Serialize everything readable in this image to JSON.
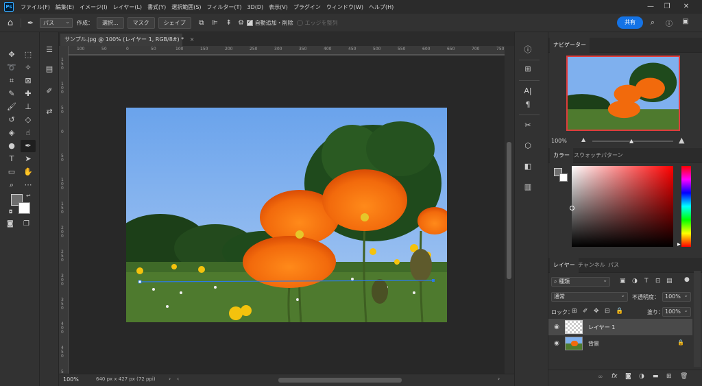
{
  "app": {
    "logo": "Ps"
  },
  "menu": [
    "ファイル(F)",
    "編集(E)",
    "イメージ(I)",
    "レイヤー(L)",
    "書式(Y)",
    "選択範囲(S)",
    "フィルター(T)",
    "3D(D)",
    "表示(V)",
    "プラグイン",
    "ウィンドウ(W)",
    "ヘルプ(H)"
  ],
  "window_controls": {
    "minimize": "—",
    "restore": "❐",
    "close": "✕"
  },
  "options": {
    "mode_select": "パス",
    "make_label": "作成：",
    "selection_btn": "選択...",
    "mask_btn": "マスク",
    "shape_btn": "シェイプ",
    "auto_add_delete": "自動追加・削除",
    "align_edges": "エッジを整列",
    "share": "共有"
  },
  "document": {
    "tab_title": "サンプル.jpg @ 100% (レイヤー 1, RGB/8#) *",
    "zoom": "100%",
    "status_info": "640 px x 427 px (72 ppi)"
  },
  "ruler": {
    "top": [
      "100",
      "50",
      "0",
      "50",
      "100",
      "150",
      "200",
      "250",
      "300",
      "350",
      "400",
      "450",
      "500",
      "550",
      "600",
      "650",
      "700",
      "750"
    ],
    "left": [
      "1 5 0",
      "1 0 0",
      "5 0",
      "0",
      "5 0",
      "1 0 0",
      "1 5 0",
      "2 0 0",
      "2 5 0",
      "3 0 0",
      "3 5 0",
      "4 0 0",
      "4 5 0",
      "5 0 0"
    ]
  },
  "navigator": {
    "tab": "ナビゲーター",
    "zoom": "100%"
  },
  "color_panel": {
    "tabs": [
      "カラー",
      "スウォッチ",
      "パターン"
    ],
    "hue_color": "#ff0000"
  },
  "layers_panel": {
    "tabs": [
      "レイヤー",
      "チャンネル",
      "パス"
    ],
    "kind_filter": "種類",
    "blend_mode": "通常",
    "opacity_label": "不透明度：",
    "opacity_value": "100%",
    "lock_label": "ロック：",
    "fill_label": "塗り：",
    "fill_value": "100%",
    "layers": [
      {
        "name": "レイヤー 1",
        "selected": true,
        "locked": false
      },
      {
        "name": "背景",
        "selected": false,
        "locked": true
      }
    ]
  },
  "colors": {
    "accent": "#1473e6",
    "canvas_bg": "#282828",
    "ui_bg": "#323232",
    "sky": "#7fb2f0",
    "poppy": "#f26a0c"
  }
}
